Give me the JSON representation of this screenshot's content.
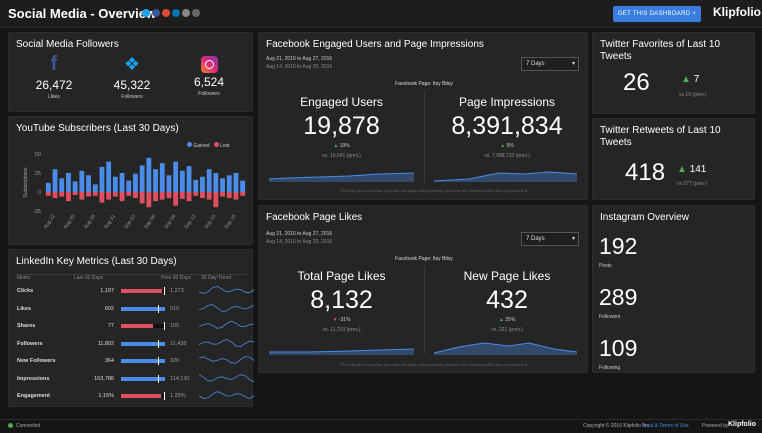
{
  "header": {
    "title": "Social Media - Overview",
    "cta": "GET THIS DASHBOARD +",
    "brand": "Klipfolio"
  },
  "followers": {
    "title": "Social Media Followers",
    "items": [
      {
        "platform": "facebook-icon",
        "value": "26,472",
        "label": "Likes",
        "color": "#3b5998"
      },
      {
        "platform": "twitter-icon",
        "value": "45,322",
        "label": "Followers",
        "color": "#1da1f2"
      },
      {
        "platform": "instagram-icon",
        "value": "6,524",
        "label": "Followers",
        "color": "#e1306c"
      }
    ]
  },
  "youtube": {
    "title": "YouTube Subscribers (Last 30 Days)",
    "legend_gained": "Gained",
    "legend_lost": "Lost",
    "ylabel": "Subscriptions",
    "yticks": [
      "50",
      "25",
      "0",
      "-25"
    ],
    "xticks": [
      "Aug 22",
      "Aug 25",
      "Aug 28",
      "Aug 31",
      "Sep 03",
      "Sep 06",
      "Sep 09",
      "Sep 12",
      "Sep 15",
      "Sep 18"
    ]
  },
  "linkedin": {
    "title": "LinkedIn Key Metrics (Last 30 Days)",
    "col_metric": "Metric",
    "col_last30": "Last 30 Days",
    "col_prev30": "Prev 30 Days",
    "col_trend": "30 Day Trend",
    "rows": [
      {
        "metric": "Clicks",
        "last": "1,197",
        "prev": "1,273",
        "fill": 0.94,
        "color": "#e04f5f"
      },
      {
        "metric": "Likes",
        "last": "602",
        "prev": "510",
        "fill": 1.0,
        "color": "#4a8de8"
      },
      {
        "metric": "Shares",
        "last": "77",
        "prev": "105",
        "fill": 0.73,
        "color": "#e04f5f"
      },
      {
        "metric": "Followers",
        "last": "11,802",
        "prev": "11,438",
        "fill": 1.0,
        "color": "#4a8de8"
      },
      {
        "metric": "New Followers",
        "last": "364",
        "prev": "326",
        "fill": 1.0,
        "color": "#4a8de8"
      },
      {
        "metric": "Impressions",
        "last": "163,786",
        "prev": "114,130",
        "fill": 1.0,
        "color": "#4a8de8"
      },
      {
        "metric": "Engagement",
        "last": "1.15%",
        "prev": "1.25%",
        "fill": 0.92,
        "color": "#e04f5f"
      }
    ]
  },
  "fb_engaged": {
    "title": "Facebook Engaged Users and Page Impressions",
    "date1": "Aug 21, 2016 to Aug 27, 2016",
    "date2": "Aug 14, 2016 to Aug 20, 2016",
    "select": "7 Days",
    "page_label": "Facebook Page: Itsy Bitsy",
    "m1_label": "Engaged Users",
    "m1_value": "19,878",
    "m1_change": "19%",
    "m1_prev": "vs. 16,641 (prev.)",
    "m2_label": "Page Impressions",
    "m2_value": "8,391,834",
    "m2_change": "9%",
    "m2_prev": "vs. 7,688,733 (prev.)",
    "note": "*This Klip does not show your data for today and yesterday, because the Facebook API does not provide it."
  },
  "fb_likes": {
    "title": "Facebook Page Likes",
    "date1": "Aug 21, 2016 to Aug 27, 2016",
    "date2": "Aug 14, 2016 to Aug 20, 2016",
    "select": "7 Days",
    "page_label": "Facebook Page: Itsy Bitsy",
    "m1_label": "Total Page Likes",
    "m1_value": "8,132",
    "m1_change": "-31%",
    "m1_prev": "vs. 11,793 (prev.)",
    "m2_label": "New Page Likes",
    "m2_value": "432",
    "m2_change": "35%",
    "m2_prev": "vs. 321 (prev.)",
    "note": "*This Klip does not show your data for today and yesterday, because the Facebook API does not provide it."
  },
  "tw_fav": {
    "title": "Twitter Favorites of Last 10 Tweets",
    "value": "26",
    "change": "7",
    "prev": "vs 19 (prev.)"
  },
  "tw_rt": {
    "title": "Twitter Retweets of Last 10 Tweets",
    "value": "418",
    "change": "141",
    "prev": "vs 277 (prev.)"
  },
  "instagram": {
    "title": "Instagram Overview",
    "items": [
      {
        "value": "192",
        "label": "Posts"
      },
      {
        "value": "289",
        "label": "Followers"
      },
      {
        "value": "109",
        "label": "Following"
      }
    ]
  },
  "footer": {
    "status": "Connected",
    "copyright": "Copyright © 2016 Klipfolio Inc.",
    "terms": "Trust & Terms of Use",
    "powered": "Powered by",
    "brand": "Klipfolio"
  },
  "chart_data": {
    "type": "bar",
    "title": "YouTube Subscribers (Last 30 Days)",
    "ylabel": "Subscriptions",
    "ylim": [
      -25,
      50
    ],
    "categories": [
      "Aug 21",
      "Aug 22",
      "Aug 23",
      "Aug 24",
      "Aug 25",
      "Aug 26",
      "Aug 27",
      "Aug 28",
      "Aug 29",
      "Aug 30",
      "Aug 31",
      "Sep 01",
      "Sep 02",
      "Sep 03",
      "Sep 04",
      "Sep 05",
      "Sep 06",
      "Sep 07",
      "Sep 08",
      "Sep 09",
      "Sep 10",
      "Sep 11",
      "Sep 12",
      "Sep 13",
      "Sep 14",
      "Sep 15",
      "Sep 16",
      "Sep 17",
      "Sep 18",
      "Sep 19"
    ],
    "series": [
      {
        "name": "Gained",
        "color": "#4a8de8",
        "values": [
          12,
          30,
          18,
          25,
          14,
          28,
          22,
          10,
          33,
          40,
          20,
          25,
          15,
          24,
          35,
          45,
          30,
          38,
          22,
          40,
          28,
          34,
          16,
          20,
          30,
          25,
          18,
          22,
          25,
          15
        ]
      },
      {
        "name": "Lost",
        "color": "#e04f5f",
        "values": [
          -5,
          -8,
          -6,
          -12,
          -4,
          -10,
          -6,
          -5,
          -14,
          -10,
          -6,
          -12,
          -5,
          -8,
          -15,
          -20,
          -12,
          -10,
          -8,
          -18,
          -9,
          -12,
          -5,
          -8,
          -10,
          -20,
          -6,
          -8,
          -10,
          -5
        ]
      }
    ]
  }
}
